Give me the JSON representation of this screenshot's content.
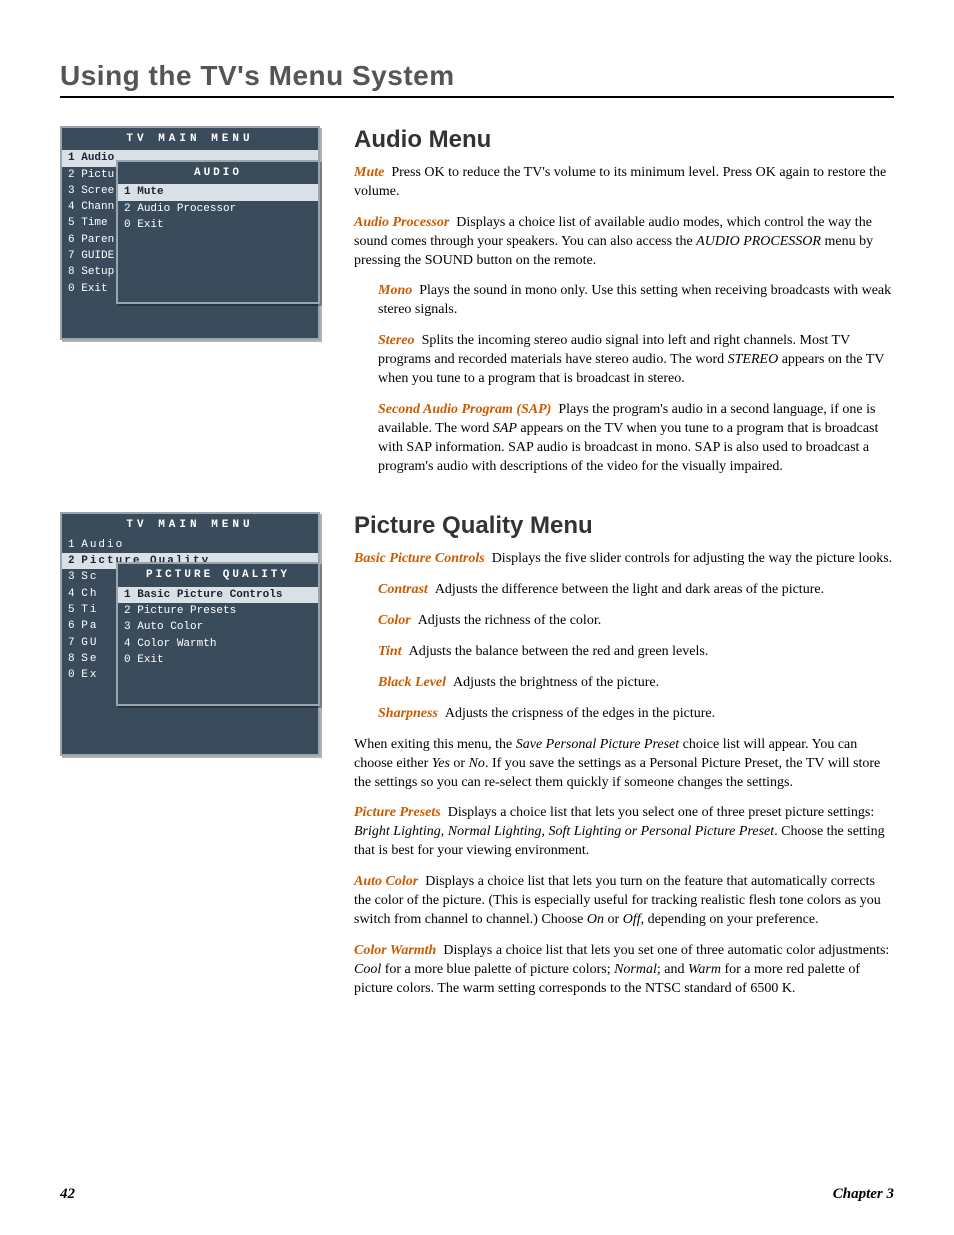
{
  "header": {
    "title": "Using the TV's Menu System"
  },
  "footer": {
    "page": "42",
    "chapter": "Chapter 3"
  },
  "osd_audio": {
    "main_title": "TV MAIN MENU",
    "main_items": [
      {
        "n": "1",
        "label": "Audio",
        "hl": true
      },
      {
        "n": "2",
        "label": "Pictu"
      },
      {
        "n": "3",
        "label": "Scree"
      },
      {
        "n": "4",
        "label": "Chann"
      },
      {
        "n": "5",
        "label": "Time"
      },
      {
        "n": "6",
        "label": "Paren"
      },
      {
        "n": "7",
        "label": "GUIDE"
      },
      {
        "n": "8",
        "label": "Setup"
      },
      {
        "n": "0",
        "label": "Exit"
      }
    ],
    "sub_title": "AUDIO",
    "sub_items": [
      {
        "n": "1",
        "label": "Mute",
        "hl": true
      },
      {
        "n": "2",
        "label": "Audio Processor"
      },
      {
        "n": "0",
        "label": "Exit"
      }
    ]
  },
  "osd_pq": {
    "main_title": "TV MAIN MENU",
    "main_items": [
      {
        "n": "1",
        "label": "Audio"
      },
      {
        "n": "2",
        "label": "Picture Quality",
        "hl": true
      },
      {
        "n": "3",
        "label": "Sc"
      },
      {
        "n": "4",
        "label": "Ch"
      },
      {
        "n": "5",
        "label": "Ti"
      },
      {
        "n": "6",
        "label": "Pa"
      },
      {
        "n": "7",
        "label": "GU"
      },
      {
        "n": "8",
        "label": "Se"
      },
      {
        "n": "0",
        "label": "Ex"
      }
    ],
    "sub_title": "PICTURE QUALITY",
    "sub_items": [
      {
        "n": "1",
        "label": "Basic Picture Controls",
        "hl": true
      },
      {
        "n": "2",
        "label": "Picture Presets"
      },
      {
        "n": "3",
        "label": "Auto Color"
      },
      {
        "n": "4",
        "label": "Color Warmth"
      },
      {
        "n": "0",
        "label": "Exit"
      }
    ]
  },
  "audio": {
    "heading": "Audio Menu",
    "mute_term": "Mute",
    "mute_text": "Press OK to reduce the TV's volume to its minimum level. Press OK again to restore the volume.",
    "ap_term": "Audio Processor",
    "ap_text1": "Displays a choice list of available audio modes, which control the way the sound comes through your speakers. You can also access the ",
    "ap_ital": "AUDIO PROCESSOR",
    "ap_text2": " menu by pressing the SOUND button on the remote.",
    "mono_term": "Mono",
    "mono_text": "Plays the sound in mono only. Use this setting when receiving broadcasts with weak stereo signals.",
    "stereo_term": "Stereo",
    "stereo_text1": "Splits the incoming stereo audio signal into left and right channels. Most TV programs and recorded materials have stereo audio. The word ",
    "stereo_ital": "STEREO",
    "stereo_text2": " appears on the TV when you tune to a program that is broadcast in stereo.",
    "sap_term": "Second Audio Program (SAP)",
    "sap_text1": "Plays the program's audio in a second language, if one is available. The word ",
    "sap_ital": "SAP",
    "sap_text2": " appears on the TV when you tune to a program that is broadcast with SAP information. SAP audio is broadcast in mono. SAP is also used to broadcast a program's audio with descriptions of the video for the visually impaired."
  },
  "pq": {
    "heading": "Picture Quality Menu",
    "bpc_term": "Basic Picture Controls",
    "bpc_text": "Displays the five slider controls for adjusting the way the picture looks.",
    "contrast_term": "Contrast",
    "contrast_text": "Adjusts the difference between the light and dark areas of the picture.",
    "color_term": "Color",
    "color_text": "Adjusts the richness of the color.",
    "tint_term": "Tint",
    "tint_text": "Adjusts the balance between the red and green levels.",
    "black_term": "Black Level",
    "black_text": "Adjusts the brightness of the picture.",
    "sharp_term": "Sharpness",
    "sharp_text": "Adjusts the crispness of the edges in the picture.",
    "exit_text1": "When exiting this menu, the ",
    "exit_ital1": "Save Personal Picture Preset",
    "exit_text2": " choice list will appear. You can choose either ",
    "exit_ital2": "Yes",
    "exit_text3": " or ",
    "exit_ital3": "No",
    "exit_text4": ". If you save the settings as a Personal Picture Preset, the TV will store the settings so you can re-select them quickly if someone changes the settings.",
    "pp_term": "Picture Presets",
    "pp_text1": "Displays a choice list that lets you select one of three preset picture settings: ",
    "pp_ital": "Bright Lighting, Normal Lighting, Soft Lighting or Personal Picture Preset",
    "pp_text2": ". Choose the setting that is best for your viewing environment.",
    "ac_term": "Auto Color",
    "ac_text1": "Displays a choice list that lets you turn on the feature that automatically corrects the color of the picture. (This is especially useful for tracking realistic flesh tone colors as you switch from channel to channel.) Choose ",
    "ac_ital1": "On",
    "ac_text2": " or ",
    "ac_ital2": "Off",
    "ac_text3": ", depending on your preference.",
    "cw_term": "Color Warmth",
    "cw_text1": "Displays a choice list that lets you set one of three automatic color adjustments: ",
    "cw_ital1": "Cool",
    "cw_text2": " for a more blue palette of picture colors; ",
    "cw_ital2": "Normal",
    "cw_text3": "; and ",
    "cw_ital3": "Warm",
    "cw_text4": " for a more red palette of picture colors. The warm setting corresponds to the NTSC standard of 6500 K."
  }
}
